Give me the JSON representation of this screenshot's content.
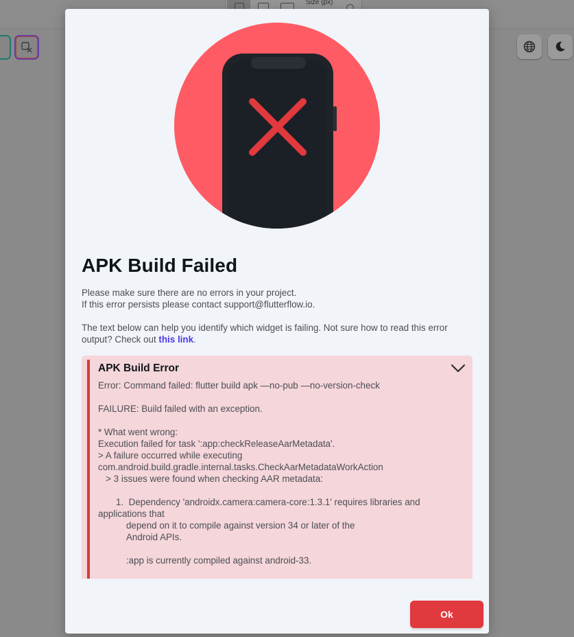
{
  "background": {
    "size_label": "Size (px)"
  },
  "modal": {
    "title": "APK Build Failed",
    "description_line1": "Please make sure there are no errors in your project.",
    "description_line2": "If this error persists please contact support@flutterflow.io.",
    "help_text": "The text below can help you identify which widget is failing. Not sure how to read this error output? Check out ",
    "help_link": "this link",
    "help_suffix": ".",
    "error_title": "APK Build Error",
    "error_output": "Error: Command failed: flutter build apk —no-pub —no-version-check\n\nFAILURE: Build failed with an exception.\n\n* What went wrong:\nExecution failed for task ':app:checkReleaseAarMetadata'.\n> A failure occurred while executing com.android.build.gradle.internal.tasks.CheckAarMetadataWorkAction\n   > 3 issues were found when checking AAR metadata:\n\n       1.  Dependency 'androidx.camera:camera-core:1.3.1' requires libraries and applications that\n           depend on it to compile against version 34 or later of the\n           Android APIs.\n\n           :app is currently compiled against android-33.",
    "ok_label": "Ok"
  },
  "icons": {
    "illustration": "phone-error-illustration",
    "expand": "chevron-down-icon",
    "language": "globe-icon",
    "theme": "moon-icon"
  },
  "colors": {
    "illustration_circle": "#fe5b64",
    "phone_body": "#1f2328",
    "error_x": "#e0393e",
    "error_panel_bg": "#f5d6da",
    "error_accent": "#d93a3a",
    "link": "#4b39ef",
    "ok_button": "#e0393e"
  }
}
